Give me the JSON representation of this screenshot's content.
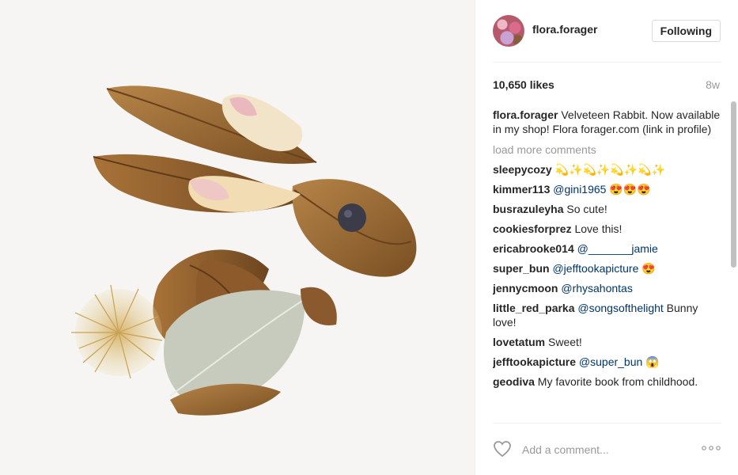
{
  "post": {
    "username": "flora.forager",
    "follow_label": "Following",
    "likes": "10,650 likes",
    "age": "8w",
    "caption_user": "flora.forager",
    "caption_text": "Velveteen Rabbit. Now available in my shop! Flora forager.com (link in profile)",
    "load_more": "load more comments",
    "comments": [
      {
        "user": "sleepycozy",
        "text": "💫✨💫✨💫✨💫✨",
        "mention": ""
      },
      {
        "user": "kimmer113",
        "text": "😍😍😍",
        "mention": "@gini1965"
      },
      {
        "user": "busrazuleyha",
        "text": "So cute!",
        "mention": ""
      },
      {
        "user": "cookiesforprez",
        "text": "Love this!",
        "mention": ""
      },
      {
        "user": "ericabrooke014",
        "text": "",
        "mention": "@_______jamie"
      },
      {
        "user": "super_bun",
        "text": "😍",
        "mention": "@jefftookapicture"
      },
      {
        "user": "jennycmoon",
        "text": "",
        "mention": "@rhysahontas"
      },
      {
        "user": "little_red_parka",
        "text": "Bunny love!",
        "mention": "@songsofthelight"
      },
      {
        "user": "lovetatum",
        "text": "Sweet!",
        "mention": ""
      },
      {
        "user": "jefftookapicture",
        "text": "😱",
        "mention": "@super_bun"
      },
      {
        "user": "geodiva",
        "text": "My favorite book from childhood.",
        "mention": ""
      }
    ],
    "comment_placeholder": "Add a comment...",
    "icons": {
      "like": "heart-icon",
      "more": "more-options-icon",
      "avatar": "avatar"
    }
  }
}
